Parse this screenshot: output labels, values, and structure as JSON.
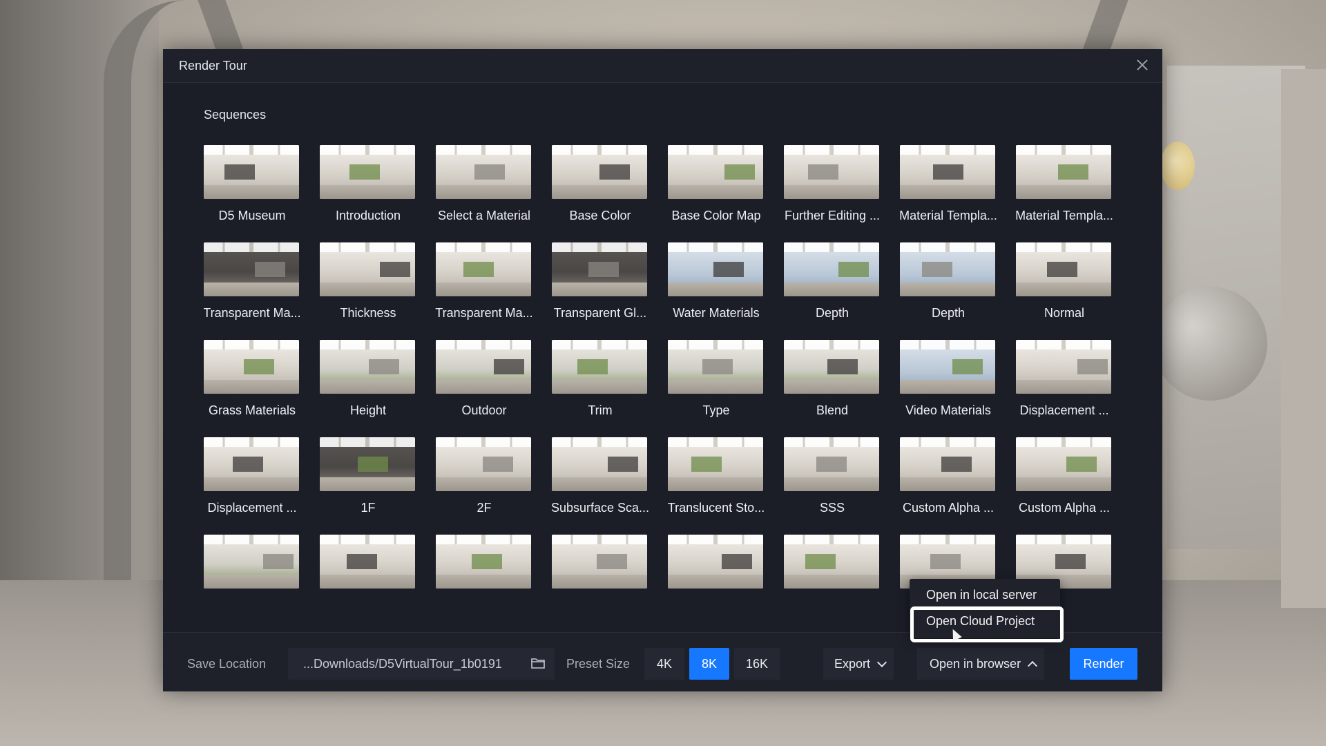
{
  "dialog": {
    "title": "Render Tour",
    "section_title": "Sequences"
  },
  "sequences": [
    {
      "label": "D5 Museum"
    },
    {
      "label": "Introduction"
    },
    {
      "label": "Select a Material"
    },
    {
      "label": "Base Color"
    },
    {
      "label": "Base Color Map"
    },
    {
      "label": "Further Editing ..."
    },
    {
      "label": "Material Templa..."
    },
    {
      "label": "Material Templa..."
    },
    {
      "label": "Transparent Ma..."
    },
    {
      "label": "Thickness"
    },
    {
      "label": "Transparent Ma..."
    },
    {
      "label": "Transparent Gl..."
    },
    {
      "label": "Water Materials"
    },
    {
      "label": "Depth"
    },
    {
      "label": "Depth"
    },
    {
      "label": "Normal"
    },
    {
      "label": "Grass Materials"
    },
    {
      "label": "Height"
    },
    {
      "label": "Outdoor"
    },
    {
      "label": "Trim"
    },
    {
      "label": "Type"
    },
    {
      "label": "Blend"
    },
    {
      "label": "Video Materials"
    },
    {
      "label": "Displacement ..."
    },
    {
      "label": "Displacement ..."
    },
    {
      "label": "1F"
    },
    {
      "label": "2F"
    },
    {
      "label": "Subsurface Sca..."
    },
    {
      "label": "Translucent Sto..."
    },
    {
      "label": "SSS"
    },
    {
      "label": "Custom Alpha ..."
    },
    {
      "label": "Custom Alpha ..."
    },
    {
      "label": ""
    },
    {
      "label": ""
    },
    {
      "label": ""
    },
    {
      "label": ""
    },
    {
      "label": ""
    },
    {
      "label": ""
    },
    {
      "label": ""
    },
    {
      "label": ""
    }
  ],
  "bottom_bar": {
    "save_location_label": "Save Location",
    "save_path": "...Downloads/D5VirtualTour_1b0191",
    "preset_size_label": "Preset Size",
    "sizes": [
      "4K",
      "8K",
      "16K"
    ],
    "selected_size": "8K",
    "export_label": "Export",
    "open_mode_label": "Open in browser",
    "render_label": "Render"
  },
  "dropdown": {
    "items": [
      "Open in local server",
      "Open Cloud Project"
    ],
    "highlighted": "Open Cloud Project"
  },
  "colors": {
    "accent": "#1677ff",
    "dialog_bg": "#1b1e27",
    "control_bg": "#252833"
  }
}
